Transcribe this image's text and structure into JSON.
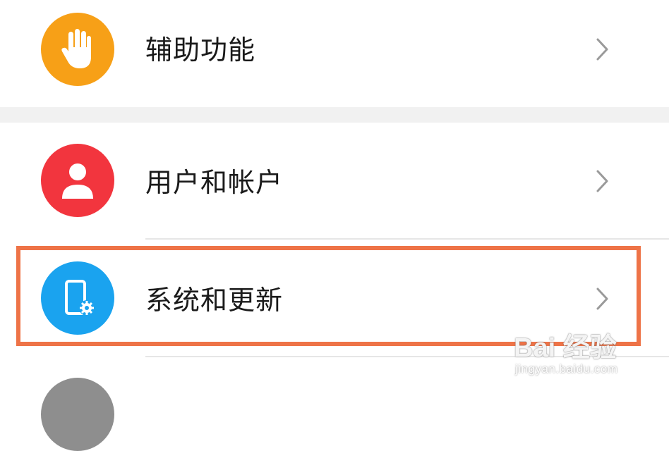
{
  "settings": {
    "items": [
      {
        "label": "辅助功能",
        "icon": "hand-icon",
        "color": "#f7a017"
      },
      {
        "label": "用户和帐户",
        "icon": "user-icon",
        "color": "#f2353e"
      },
      {
        "label": "系统和更新",
        "icon": "phone-settings-icon",
        "color": "#1aa3ef"
      }
    ],
    "next_item_icon_color": "#8e8e8e"
  },
  "highlight": {
    "color": "#ee7347",
    "target": "系统和更新"
  },
  "watermark": {
    "brand": "Bai 经验",
    "url": "jingyan.baidu.com"
  }
}
